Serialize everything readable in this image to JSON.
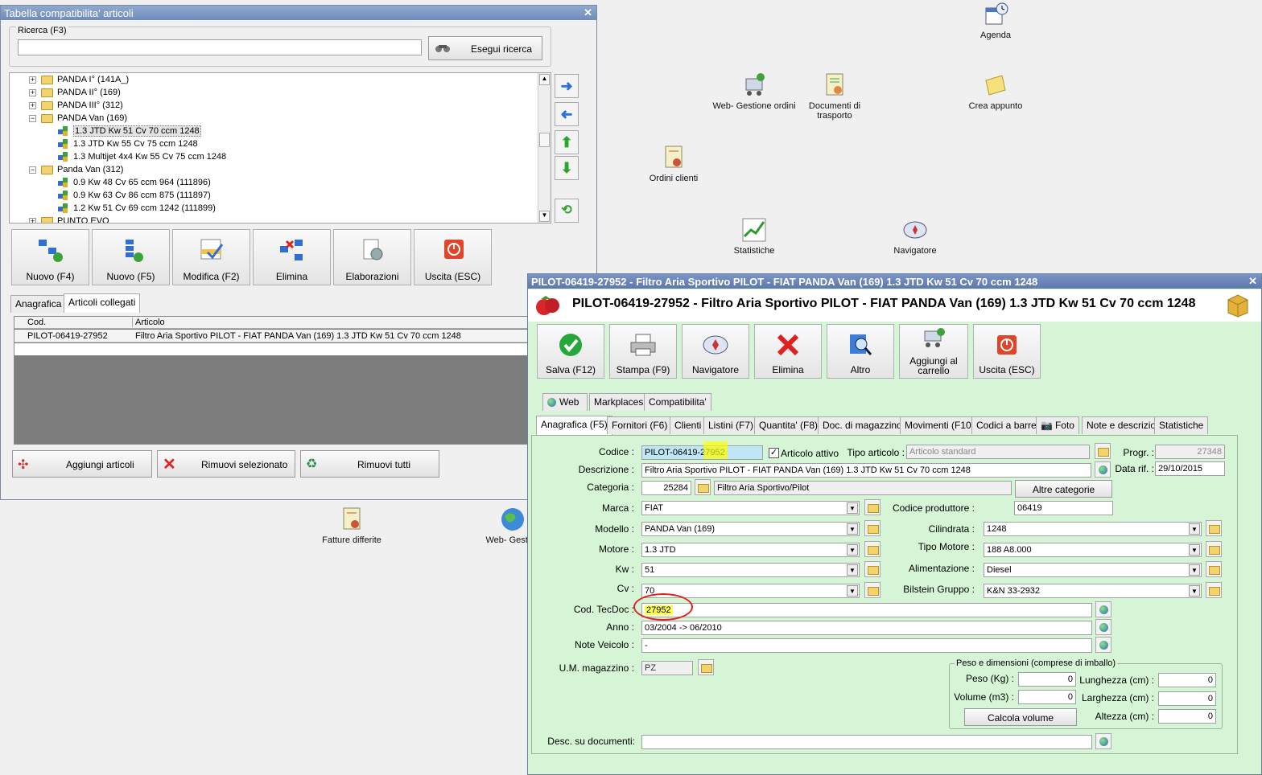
{
  "desktop": {
    "icons": [
      {
        "id": "agenda",
        "label": "Agenda"
      },
      {
        "id": "web-gestione-ordini",
        "label": "Web- Gestione ordini"
      },
      {
        "id": "documenti-trasporto",
        "label": "Documenti di trasporto"
      },
      {
        "id": "crea-appunto",
        "label": "Crea appunto"
      },
      {
        "id": "ordini-clienti",
        "label": "Ordini clienti"
      },
      {
        "id": "statistiche",
        "label": "Statistiche"
      },
      {
        "id": "navigatore",
        "label": "Navigatore"
      },
      {
        "id": "fatture-differite",
        "label": "Fatture differite"
      },
      {
        "id": "web-gestion",
        "label": "Web- Gestion"
      }
    ]
  },
  "compat_window": {
    "title": "Tabella compatibilita' articoli",
    "search_group": "Ricerca (F3)",
    "search_value": "",
    "search_button": "Esegui ricerca",
    "tree": [
      {
        "type": "folder",
        "label": "PANDA I° (141A_)",
        "expand": "+"
      },
      {
        "type": "folder",
        "label": "PANDA II° (169)",
        "expand": "+"
      },
      {
        "type": "folder",
        "label": "PANDA III° (312)",
        "expand": "+"
      },
      {
        "type": "folder",
        "label": "PANDA Van (169)",
        "expand": "−"
      },
      {
        "type": "leaf",
        "label": "1.3 JTD Kw 51 Cv 70 ccm 1248",
        "selected": true
      },
      {
        "type": "leaf",
        "label": "1.3 JTD Kw 55 Cv 75 ccm 1248"
      },
      {
        "type": "leaf",
        "label": "1.3 Multijet 4x4 Kw 55 Cv 75 ccm 1248"
      },
      {
        "type": "folder",
        "label": "Panda Van (312)",
        "expand": "−"
      },
      {
        "type": "leaf",
        "label": "0.9 Kw 48 Cv 65 ccm 964 (111896)"
      },
      {
        "type": "leaf",
        "label": "0.9 Kw 63 Cv 86 ccm 875 (111897)"
      },
      {
        "type": "leaf",
        "label": "1.2 Kw 51 Cv 69 ccm 1242 (111899)"
      },
      {
        "type": "folder",
        "label": "PUNTO EVO",
        "expand": "+"
      }
    ],
    "toolbar": [
      "Nuovo (F4)",
      "Nuovo (F5)",
      "Modifica (F2)",
      "Elimina",
      "Elaborazioni",
      "Uscita (ESC)"
    ],
    "tabs": [
      "Anagrafica",
      "Articoli collegati"
    ],
    "grid_headers": [
      "Cod.",
      "Articolo"
    ],
    "grid_rows": [
      {
        "cod": "PILOT-06419-27952",
        "articolo": "Filtro Aria Sportivo PILOT - FIAT PANDA Van (169) 1.3 JTD Kw 51 Cv 70 ccm 1248"
      }
    ],
    "bottom_buttons": [
      "Aggiungi articoli",
      "Rimuovi selezionato",
      "Rimuovi tutti"
    ]
  },
  "article_window": {
    "title": "PILOT-06419-27952 - Filtro Aria Sportivo PILOT - FIAT PANDA Van (169) 1.3 JTD Kw 51 Cv 70 ccm 1248",
    "heading": "PILOT-06419-27952 - Filtro Aria Sportivo PILOT - FIAT PANDA Van (169) 1.3 JTD Kw 51 Cv 70 ccm 1248",
    "toolbar": [
      "Salva (F12)",
      "Stampa (F9)",
      "Navigatore",
      "Elimina",
      "Altro",
      "Aggiungi al carrello",
      "Uscita (ESC)"
    ],
    "tabs_top": [
      "Web",
      "Markplaces",
      "Compatibilita'"
    ],
    "tabs_main": [
      "Anagrafica (F5)",
      "Fornitori (F6)",
      "Clienti",
      "Listini (F7)",
      "Quantita' (F8)",
      "Doc. di magazzino",
      "Movimenti (F10)",
      "Codici a barre",
      "Foto",
      "Note e descrizioni",
      "Statistiche"
    ],
    "labels": {
      "codice": "Codice :",
      "articolo_attivo": "Articolo attivo",
      "tipo_articolo": "Tipo articolo :",
      "progr": "Progr. :",
      "descrizione": "Descrizione :",
      "data_rif": "Data rif. :",
      "categoria": "Categoria :",
      "altre_categorie": "Altre categorie",
      "marca": "Marca :",
      "codice_produttore": "Codice produttore :",
      "modello": "Modello :",
      "cilindrata": "Cilindrata :",
      "motore": "Motore :",
      "tipo_motore": "Tipo Motore :",
      "kw": "Kw :",
      "alimentazione": "Alimentazione :",
      "cv": "Cv :",
      "bilstein": "Bilstein Gruppo :",
      "cod_tecdoc": "Cod. TecDoc :",
      "anno": "Anno :",
      "note_veicolo": "Note Veicolo :",
      "um_magazzino": "U.M. magazzino :",
      "peso_group": "Peso e dimensioni (comprese di imballo)",
      "peso": "Peso (Kg) :",
      "lunghezza": "Lunghezza (cm) :",
      "volume": "Volume (m3) :",
      "larghezza": "Larghezza (cm) :",
      "altezza": "Altezza (cm) :",
      "calcola_volume": "Calcola volume",
      "desc_documenti": "Desc. su documenti:"
    },
    "values": {
      "codice": "PILOT-06419-27952",
      "tipo_articolo": "Articolo standard",
      "progr": "27348",
      "descrizione": "Filtro Aria Sportivo PILOT - FIAT PANDA Van (169) 1.3 JTD Kw 51 Cv 70 ccm 1248",
      "data_rif": "29/10/2015",
      "categoria_code": "25284",
      "categoria_desc": "Filtro Aria Sportivo/Pilot",
      "marca": "FIAT",
      "codice_produttore": "06419",
      "modello": "PANDA Van (169)",
      "cilindrata": "1248",
      "motore": "1.3 JTD",
      "tipo_motore": "188 A8.000",
      "kw": "51",
      "alimentazione": "Diesel",
      "cv": "70",
      "bilstein": "K&N 33-2932",
      "cod_tecdoc": "27952",
      "anno": "03/2004 -> 06/2010",
      "note_veicolo": "-",
      "um_magazzino": "PZ",
      "peso": "0",
      "lunghezza": "0",
      "volume": "0",
      "larghezza": "0",
      "altezza": "0",
      "desc_documenti": ""
    },
    "colors": {
      "background": "#d6f5d6",
      "highlight": "#ffff4d",
      "annotation": "#e02020"
    }
  }
}
